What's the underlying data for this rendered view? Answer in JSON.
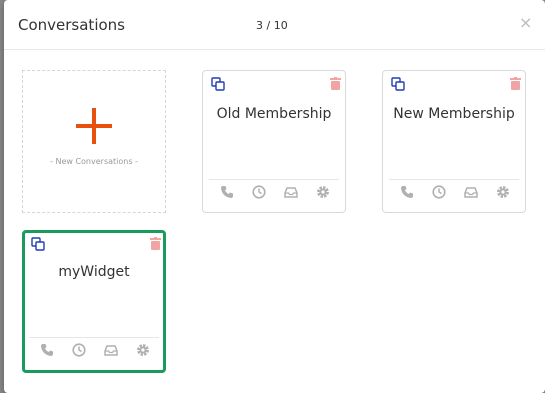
{
  "modal": {
    "title": "Conversations",
    "counter": "3 / 10",
    "close_glyph": "×"
  },
  "new_card": {
    "label": "- New Conversations -"
  },
  "cards": [
    {
      "name": "Old Membership",
      "selected": false
    },
    {
      "name": "New Membership",
      "selected": false
    },
    {
      "name": "myWidget",
      "selected": true
    }
  ],
  "icons": {
    "copy": "copy-icon",
    "delete": "trash-icon",
    "footer": [
      "phone-icon",
      "clock-icon",
      "inbox-icon",
      "gear-icon"
    ]
  },
  "colors": {
    "accent_plus": "#e8500e",
    "copy_icon": "#1e3fb4",
    "trash_icon": "#f2a4a4",
    "footer_icon": "#b0b0b0",
    "selected_border": "#1a9a5c"
  }
}
